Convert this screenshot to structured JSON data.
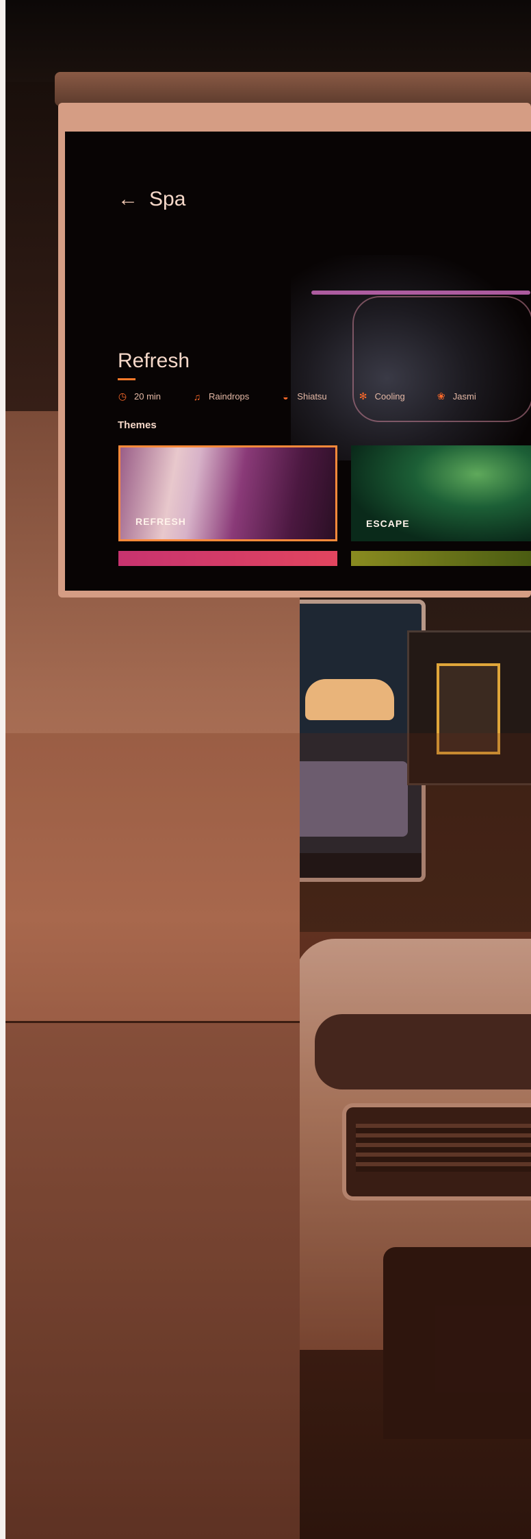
{
  "screen": {
    "title": "Spa"
  },
  "hero": {
    "title": "Refresh",
    "meta": [
      {
        "icon": "timer-icon",
        "label": "20 min"
      },
      {
        "icon": "music-note-icon",
        "label": "Raindrops"
      },
      {
        "icon": "massage-seat-icon",
        "label": "Shiatsu"
      },
      {
        "icon": "snowflake-icon",
        "label": "Cooling"
      },
      {
        "icon": "scent-icon",
        "label": "Jasmi"
      }
    ]
  },
  "themes": {
    "label": "Themes",
    "items": [
      {
        "label": "REFRESH",
        "selected": true
      },
      {
        "label": "ESCAPE",
        "selected": false
      }
    ]
  },
  "colors": {
    "accent": "#ff7a2a",
    "selected_border": "#ff8a3a"
  }
}
